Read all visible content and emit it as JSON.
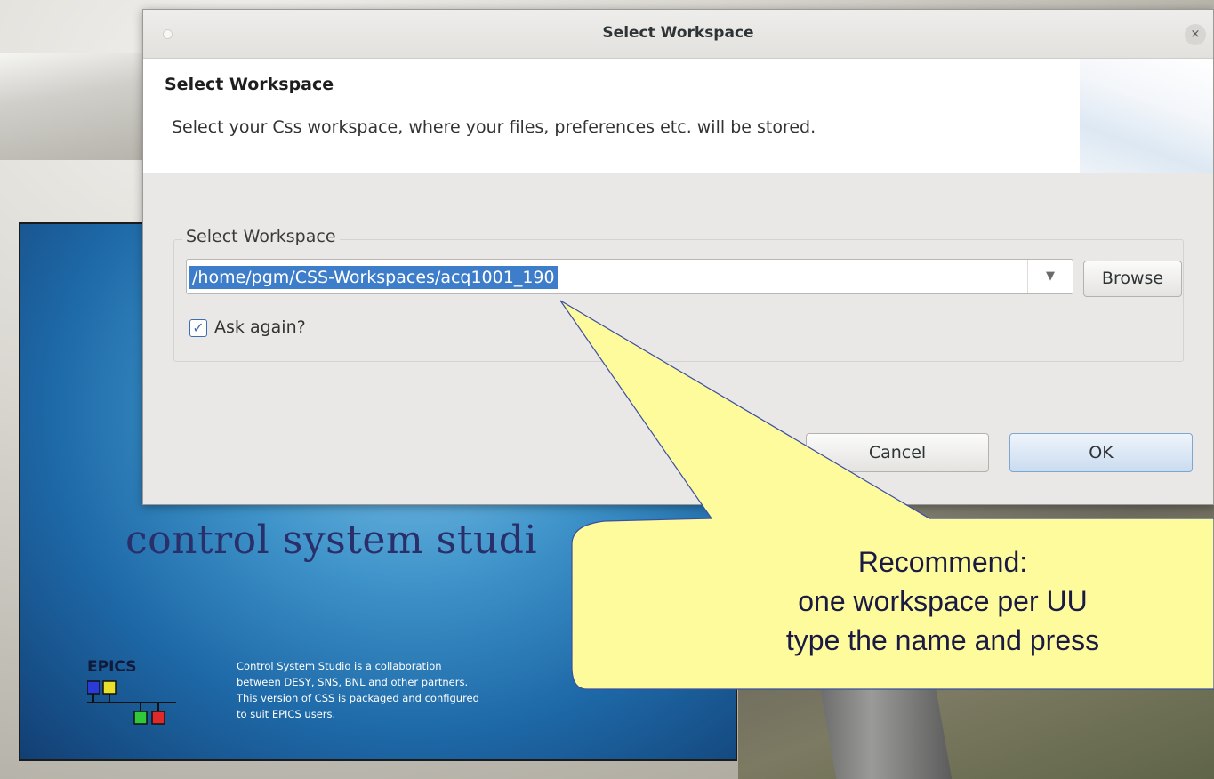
{
  "dialog": {
    "window_title": "Select Workspace",
    "close_glyph": "×",
    "header_title": "Select Workspace",
    "header_description": "Select your Css workspace, where your files, preferences etc. will be stored.",
    "group_label": "Select Workspace",
    "workspace_path": "/home/pgm/CSS-Workspaces/acq1001_190",
    "dropdown_glyph": "▼",
    "browse_label": "Browse",
    "ask_again_label": "Ask again?",
    "ask_again_checked": true,
    "cancel_label": "Cancel",
    "ok_label": "OK"
  },
  "splash": {
    "title": "control system studi",
    "epics_label": "EPICS",
    "description_lines": [
      "Control System Studio is a collaboration",
      "between DESY, SNS, BNL and other partners.",
      "This version of CSS is packaged and configured",
      "to suit EPICS users."
    ],
    "logo_colors": [
      "#2a3bd6",
      "#e8e02a",
      "#2fc93a",
      "#e02a2a"
    ]
  },
  "callout": {
    "lines": [
      "Recommend:",
      "one workspace per UU",
      "type the name and press"
    ],
    "fill_color": "#fdfb9c",
    "stroke_color": "#3b4fa0"
  }
}
